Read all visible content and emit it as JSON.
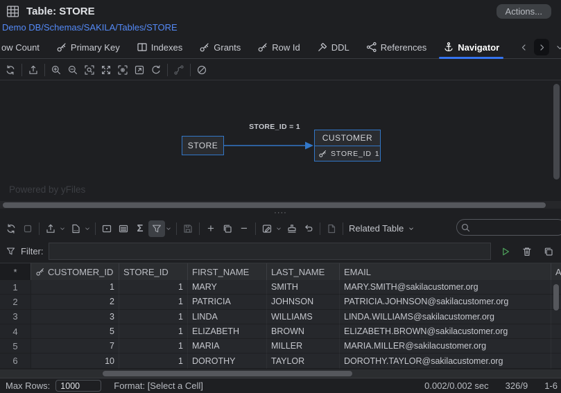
{
  "window": {
    "title": "Table: STORE",
    "breadcrumb": "Demo DB/Schemas/SAKILA/Tables/STORE",
    "actions_button_label": "Actions..."
  },
  "tabs": [
    {
      "label": "ow Count"
    },
    {
      "label": "Primary Key"
    },
    {
      "label": "Indexes"
    },
    {
      "label": "Grants"
    },
    {
      "label": "Row Id"
    },
    {
      "label": "DDL"
    },
    {
      "label": "References"
    },
    {
      "label": "Navigator"
    }
  ],
  "diagram": {
    "store_node_label": "STORE",
    "customer_node_label": "CUSTOMER",
    "customer_attr_name": "STORE_ID",
    "customer_attr_value": "1",
    "edge_label": "STORE_ID = 1",
    "watermark": "Powered by yFiles"
  },
  "splitter_dots": "····",
  "results_toolbar": {
    "sigma_label": "Σ",
    "plus_label": "+",
    "minus_label": "−",
    "related_table_label": "Related Table",
    "search_value": ""
  },
  "filter_bar": {
    "label": "Filter:",
    "value": ""
  },
  "grid": {
    "corner_header": "*",
    "columns": [
      "CUSTOMER_ID",
      "STORE_ID",
      "FIRST_NAME",
      "LAST_NAME",
      "EMAIL"
    ],
    "overflow_column": "A",
    "rows": [
      {
        "num": "1",
        "customer_id": "1",
        "store_id": "1",
        "first_name": "MARY",
        "last_name": "SMITH",
        "email": "MARY.SMITH@sakilacustomer.org"
      },
      {
        "num": "2",
        "customer_id": "2",
        "store_id": "1",
        "first_name": "PATRICIA",
        "last_name": "JOHNSON",
        "email": "PATRICIA.JOHNSON@sakilacustomer.org"
      },
      {
        "num": "3",
        "customer_id": "3",
        "store_id": "1",
        "first_name": "LINDA",
        "last_name": "WILLIAMS",
        "email": "LINDA.WILLIAMS@sakilacustomer.org"
      },
      {
        "num": "4",
        "customer_id": "5",
        "store_id": "1",
        "first_name": "ELIZABETH",
        "last_name": "BROWN",
        "email": "ELIZABETH.BROWN@sakilacustomer.org"
      },
      {
        "num": "5",
        "customer_id": "7",
        "store_id": "1",
        "first_name": "MARIA",
        "last_name": "MILLER",
        "email": "MARIA.MILLER@sakilacustomer.org"
      },
      {
        "num": "6",
        "customer_id": "10",
        "store_id": "1",
        "first_name": "DOROTHY",
        "last_name": "TAYLOR",
        "email": "DOROTHY.TAYLOR@sakilacustomer.org"
      }
    ]
  },
  "status_bar": {
    "max_rows_label": "Max Rows:",
    "max_rows_value": "1000",
    "format_text": "Format: [Select a Cell]",
    "timing": "0.002/0.002 sec",
    "counts": "326/9",
    "visible_range": "1-6"
  },
  "colors": {
    "accent_blue": "#3574f0",
    "link_blue": "#548af7",
    "diagram_blue": "#3277c8",
    "run_green": "#4fa45c"
  }
}
